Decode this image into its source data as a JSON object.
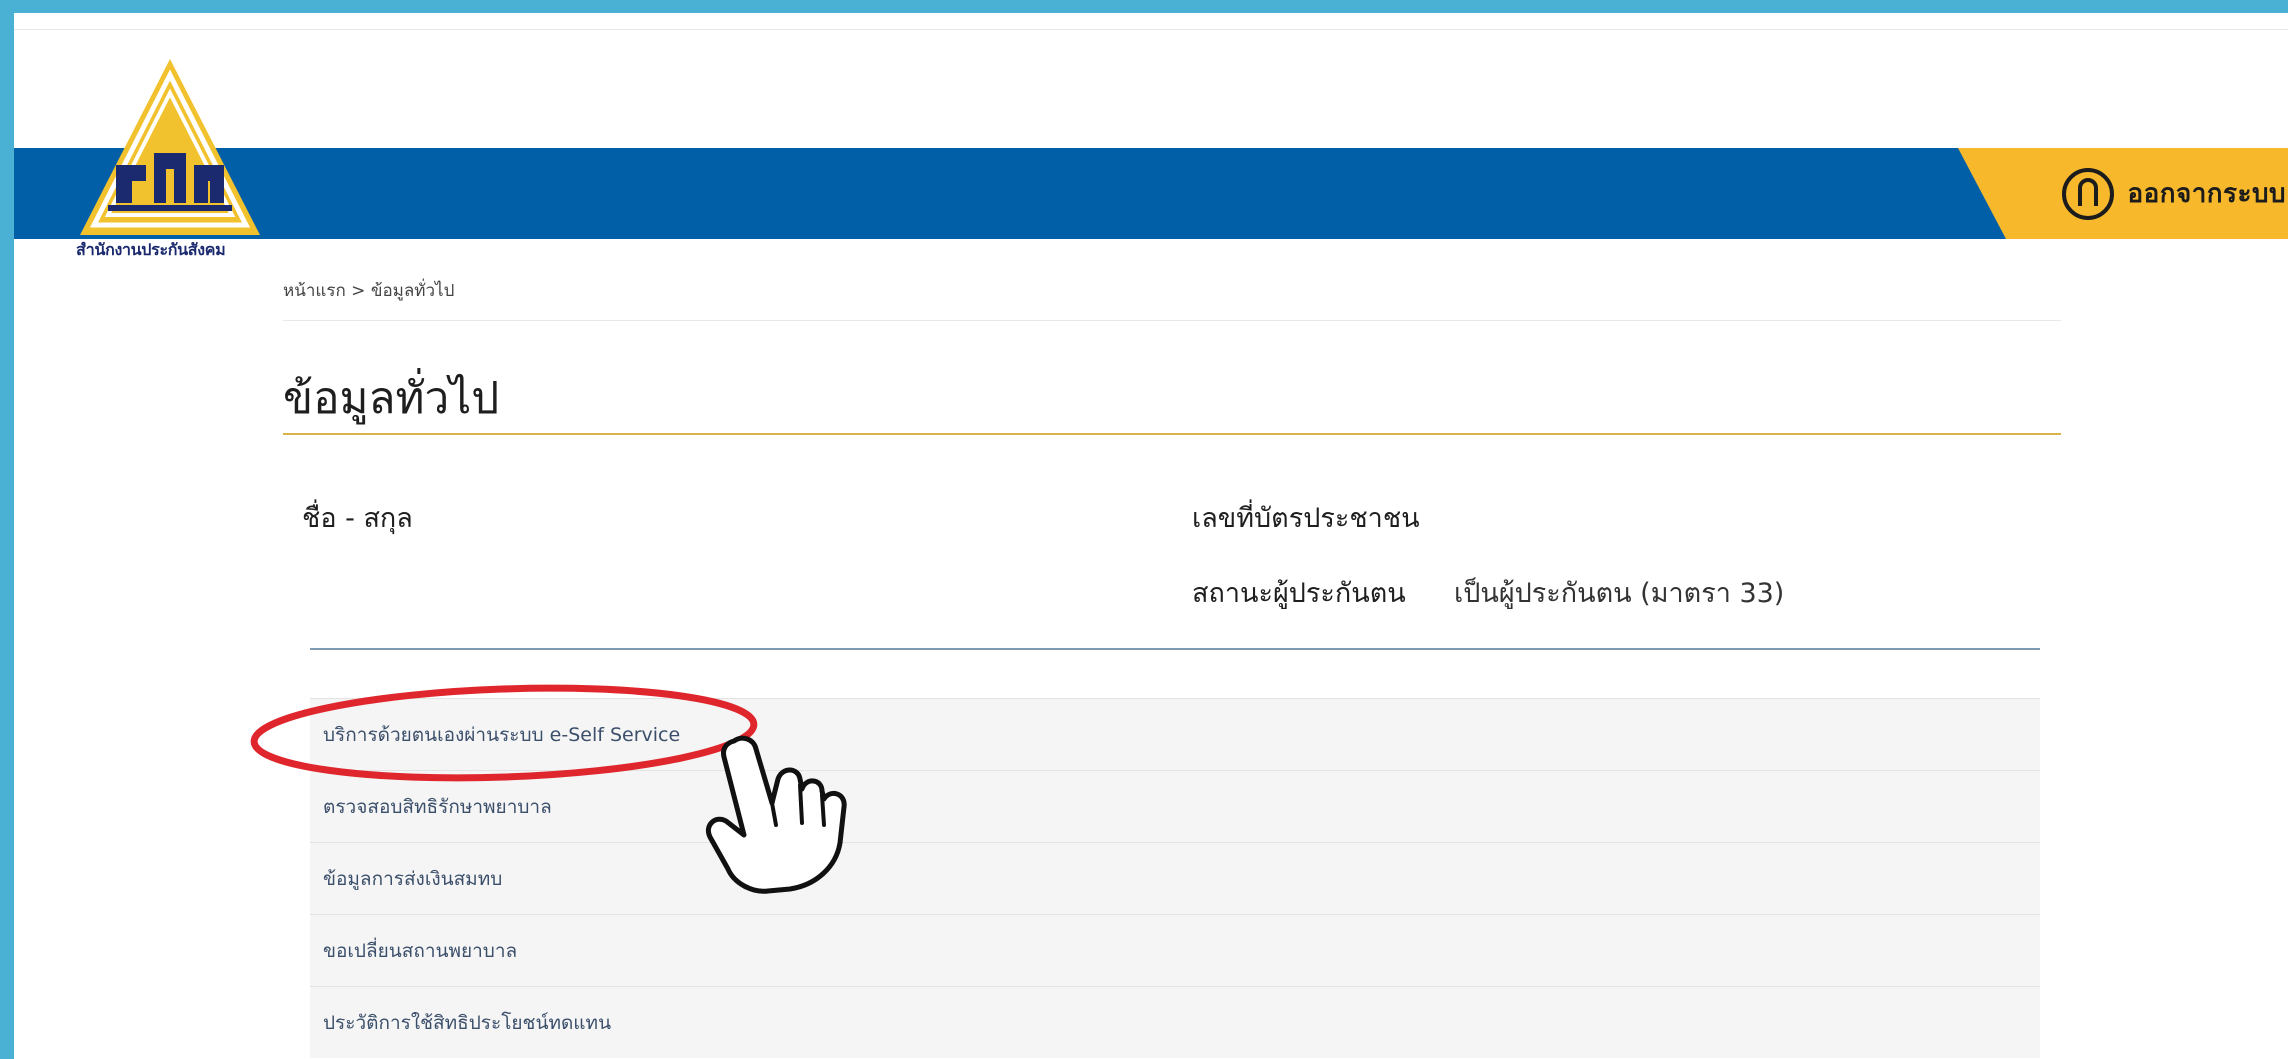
{
  "header": {
    "logo_caption": "สำนักงานประกันสังคม",
    "logout_label": "ออกจากระบบ"
  },
  "breadcrumb": {
    "home": "หน้าแรก",
    "separator": ">",
    "current": "ข้อมูลทั่วไป"
  },
  "page_title": "ข้อมูลทั่วไป",
  "info": {
    "name_label": "ชื่อ - สกุล",
    "id_label": "เลขที่บัตรประชาชน",
    "status_label": "สถานะผู้ประกันตน",
    "status_value": "เป็นผู้ประกันตน (มาตรา 33)"
  },
  "menu": {
    "items": [
      {
        "label": "บริการด้วยตนเองผ่านระบบ e-Self Service"
      },
      {
        "label": "ตรวจสอบสิทธิรักษาพยาบาล"
      },
      {
        "label": "ข้อมูลการส่งเงินสมทบ"
      },
      {
        "label": "ขอเปลี่ยนสถานพยาบาล"
      },
      {
        "label": "ประวัติการใช้สิทธิประโยชน์ทดแทน"
      }
    ]
  },
  "colors": {
    "header_blue": "#005fa6",
    "logout_yellow": "#f7b82b",
    "title_underline": "#d9b24c",
    "highlight_red": "#e0262d"
  },
  "icons": {
    "logout": "power-icon",
    "pointer": "pointing-hand-icon"
  }
}
